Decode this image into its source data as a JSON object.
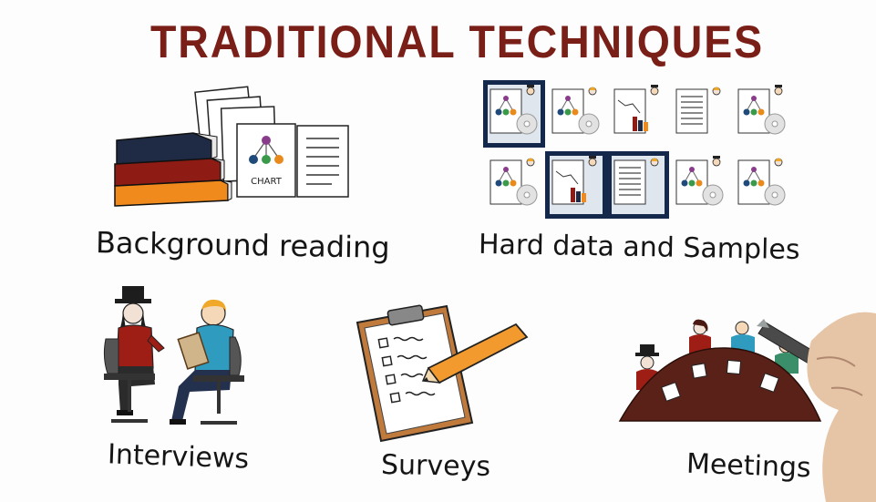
{
  "slide": {
    "title": "TRADITIONAL TECHNIQUES",
    "sections": {
      "background_reading": {
        "label": "Background reading",
        "chart_text": "CHART"
      },
      "hard_data": {
        "label": "Hard data and Samples"
      },
      "interviews": {
        "label": "Interviews"
      },
      "surveys": {
        "label": "Surveys"
      },
      "meetings": {
        "label": "Meetings"
      }
    }
  },
  "colors": {
    "title": "#7a1f17",
    "book_top": "#1f2b44",
    "book_middle": "#8e1c14",
    "book_bottom": "#f08a1c",
    "pencil": "#f29a2e",
    "table": "#5a2118"
  }
}
